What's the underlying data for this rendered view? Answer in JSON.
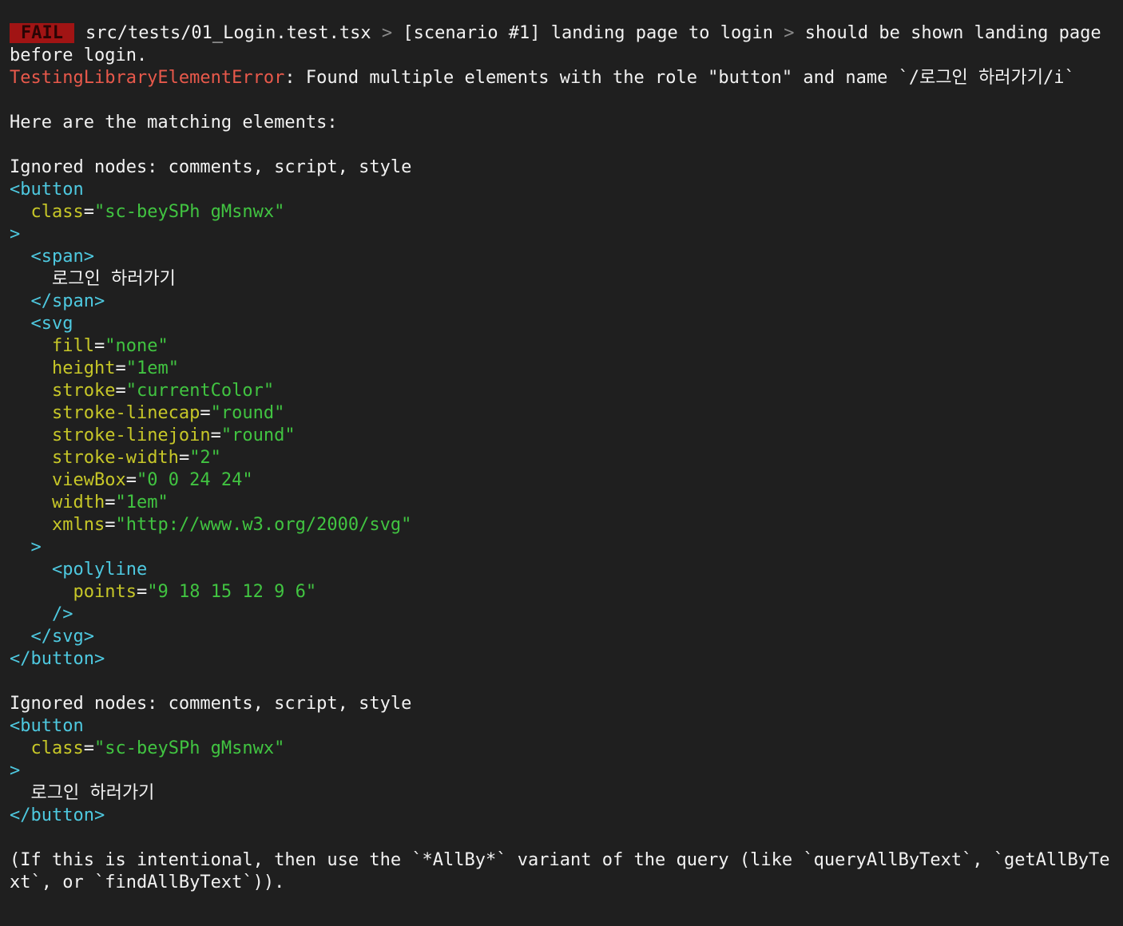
{
  "header": {
    "badge": "FAIL",
    "path": "src/tests/01_Login.test.tsx",
    "separator": ">",
    "scenario": "[scenario #1] landing page to login",
    "test_name": "should be shown landing page before login."
  },
  "error": {
    "type": "TestingLibraryElementError",
    "message": ": Found multiple elements with the role \"button\" and name `/로그인 하러가기/i`"
  },
  "intro": "Here are the matching elements:",
  "ignored_nodes": "Ignored nodes: comments, script, style",
  "elements": [
    {
      "open_tag": "<button",
      "class_attr": "class",
      "class_val": "\"sc-beySPh gMsnwx\"",
      "close_bracket": ">",
      "span_open": "<span>",
      "span_text": "로그인 하러가기",
      "span_close": "</span>",
      "svg_open": "<svg",
      "svg_attrs": [
        {
          "name": "fill",
          "value": "\"none\""
        },
        {
          "name": "height",
          "value": "\"1em\""
        },
        {
          "name": "stroke",
          "value": "\"currentColor\""
        },
        {
          "name": "stroke-linecap",
          "value": "\"round\""
        },
        {
          "name": "stroke-linejoin",
          "value": "\"round\""
        },
        {
          "name": "stroke-width",
          "value": "\"2\""
        },
        {
          "name": "viewBox",
          "value": "\"0 0 24 24\""
        },
        {
          "name": "width",
          "value": "\"1em\""
        },
        {
          "name": "xmlns",
          "value": "\"http://www.w3.org/2000/svg\""
        }
      ],
      "svg_close_bracket": ">",
      "polyline_open": "<polyline",
      "polyline_attr": "points",
      "polyline_val": "\"9 18 15 12 9 6\"",
      "polyline_close": "/>",
      "svg_close": "</svg>",
      "close_tag": "</button>"
    },
    {
      "open_tag": "<button",
      "class_attr": "class",
      "class_val": "\"sc-beySPh gMsnwx\"",
      "close_bracket": ">",
      "text": "로그인 하러가기",
      "close_tag": "</button>"
    }
  ],
  "footer": "(If this is intentional, then use the `*AllBy*` variant of the query (like `queryAllByText`, `getAllByText`, or `findAllByText`))."
}
